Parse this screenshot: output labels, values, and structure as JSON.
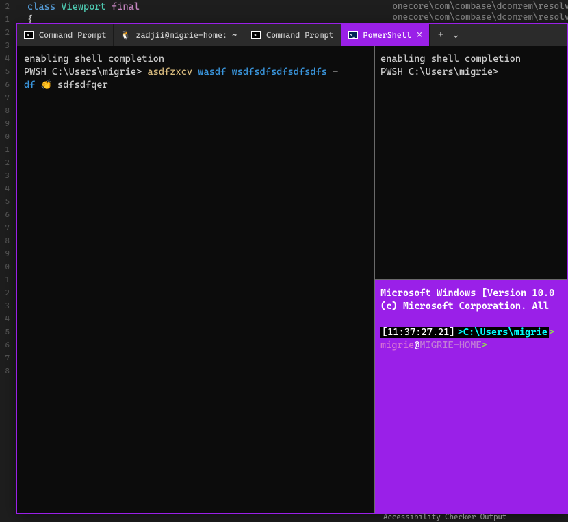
{
  "background": {
    "code_line1_class": "class",
    "code_line1_name": "Viewport",
    "code_line1_final": "final",
    "code_line2": "{",
    "path_line": "onecore\\com\\combase\\dcomrem\\resolve",
    "path_line2": "onecore\\com\\combase\\dcomrem\\resolve",
    "gutter_nums": [
      "2",
      "",
      "",
      "",
      "",
      "",
      "",
      "",
      "",
      "1",
      "2",
      "3",
      "4",
      "5",
      "6",
      "7",
      "8",
      "9",
      "0",
      "1",
      "2",
      "3",
      "4",
      "5",
      "6",
      "7",
      "8",
      "9",
      "0",
      "1",
      "2",
      "3",
      "4",
      "5",
      "6",
      "7",
      "8"
    ]
  },
  "tabs": [
    {
      "label": "Command Prompt",
      "icon": "cmd"
    },
    {
      "label": "zadjii@migrie-home: ~",
      "icon": "linux"
    },
    {
      "label": "Command Prompt",
      "icon": "cmd"
    },
    {
      "label": "PowerShell",
      "icon": "ps",
      "active": true
    }
  ],
  "pane_left": {
    "line1": "enabling shell completion",
    "prompt": "PWSH C:\\Users\\migrie>",
    "cmd_part1": "asdfzxcv",
    "cmd_part2": "wasdf wsdfsdfsdfsdfsdfs",
    "cmd_dash": "-",
    "cmd_line2a": "df",
    "cmd_emoji": "👏",
    "cmd_line2b": "sdfsdfqer"
  },
  "pane_right_top": {
    "line1": "enabling shell completion",
    "prompt": "PWSH C:\\Users\\migrie>"
  },
  "pane_right_bottom": {
    "line1": "Microsoft Windows [Version 10.0",
    "line2": "(c) Microsoft Corporation. All",
    "time_prefix": "[",
    "time": "11:37:27.21",
    "time_suffix": "]",
    "path_arrow": ">",
    "path": "C:\\Users\\migrie",
    "path_arrow2": ">",
    "user": "migrie",
    "at": "@",
    "host": "MIGRIE-HOME",
    "prompt_arrow": ">"
  },
  "status": {
    "text": "Accessibility Checker    Output"
  }
}
